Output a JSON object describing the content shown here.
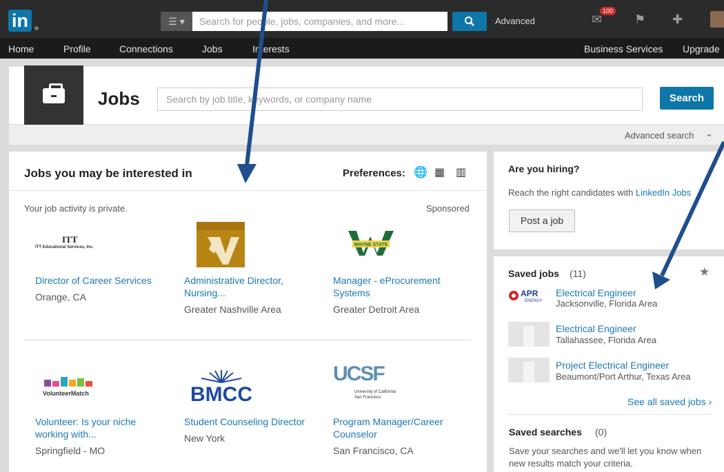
{
  "topbar": {
    "logo": "in",
    "search_placeholder": "Search for people, jobs, companies, and more...",
    "advanced": "Advanced",
    "notifications_badge": "100"
  },
  "nav": {
    "items": [
      "Home",
      "Profile",
      "Connections",
      "Jobs",
      "Interests",
      "Business Services",
      "Upgrade"
    ]
  },
  "jobs_header": {
    "title": "Jobs",
    "search_placeholder": "Search by job title, keywords, or company name",
    "search_button": "Search",
    "advanced_search": "Advanced search"
  },
  "recommended": {
    "title": "Jobs you may be interested in",
    "preferences_label": "Preferences:",
    "privacy_note": "Your job activity is private.",
    "sponsored": "Sponsored",
    "jobs": [
      {
        "company_logo_text": "ITT",
        "company_subtext": "ITT Educational Services, Inc.",
        "title_line1": "Director of Career Services",
        "title_line2": "",
        "location": "Orange, CA"
      },
      {
        "company_logo_text": "",
        "company_subtext": "",
        "title_line1": "Administrative Director,",
        "title_line2": "Nursing...",
        "location": "Greater Nashville Area"
      },
      {
        "company_logo_text": "WAYNE STATE",
        "company_subtext": "",
        "title_line1": "Manager - eProcurement",
        "title_line2": "Systems",
        "location": "Greater Detroit Area"
      },
      {
        "company_logo_text": "VolunteerMatch",
        "company_subtext": "",
        "title_line1": "Volunteer: Is your niche",
        "title_line2": "working with...",
        "location": "Springfield - MO"
      },
      {
        "company_logo_text": "BMCC",
        "company_subtext": "",
        "title_line1": "Student Counseling Director",
        "title_line2": "",
        "location": "New York"
      },
      {
        "company_logo_text": "UCSF",
        "company_subtext": "University of California San Francisco",
        "title_line1": "Program Manager/Career",
        "title_line2": "Counselor",
        "location": "San Francisco, CA"
      }
    ]
  },
  "hiring": {
    "title": "Are you hiring?",
    "text_prefix": "Reach the right candidates with ",
    "text_link": "LinkedIn Jobs",
    "button": "Post a job"
  },
  "saved_jobs": {
    "title": "Saved jobs",
    "count": "(11)",
    "items": [
      {
        "logo": "APR ENERGY",
        "title": "Electrical Engineer",
        "location": "Jacksonville, Florida Area"
      },
      {
        "logo": "",
        "title": "Electrical Engineer",
        "location": "Tallahassee, Florida Area"
      },
      {
        "logo": "",
        "title": "Project Electrical Engineer",
        "location": "Beaumont/Port Arthur, Texas Area"
      }
    ],
    "see_all": "See all saved jobs ›"
  },
  "saved_searches": {
    "title": "Saved searches",
    "count": "(0)",
    "text_line1": "Save your searches and we'll let you know when",
    "text_line2": "new results match your criteria."
  },
  "colors": {
    "brand": "#0e76a8",
    "link": "#1a78b4",
    "annotation_arrow": "#1f4e8c"
  }
}
